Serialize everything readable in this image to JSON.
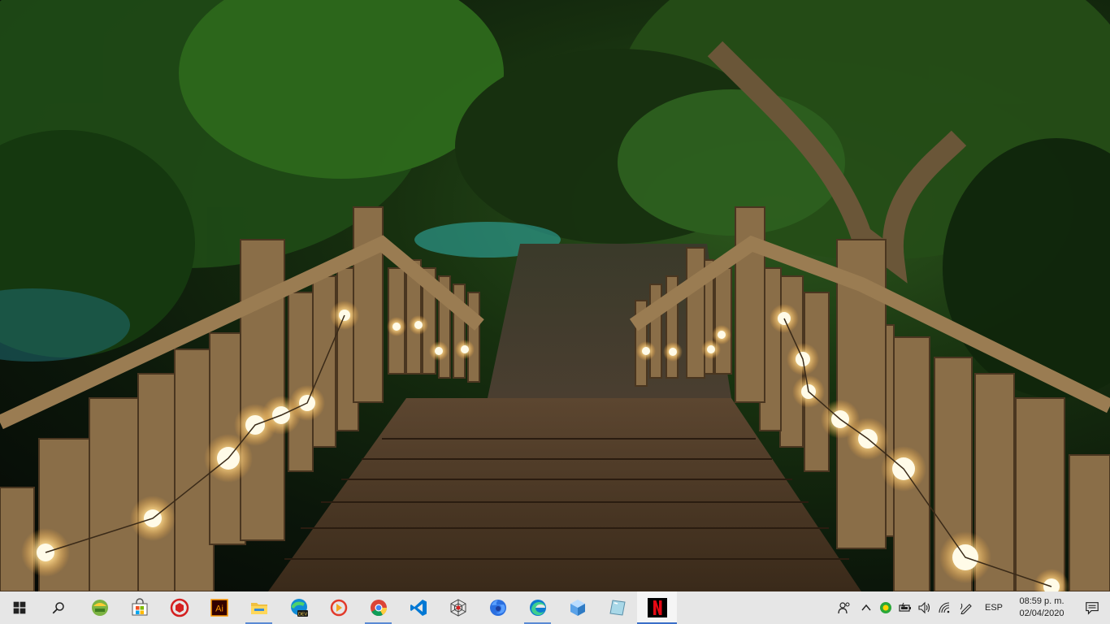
{
  "taskbar": {
    "start": {
      "icon": "windows-logo-icon"
    },
    "search": {
      "icon": "search-icon"
    },
    "apps": [
      {
        "name": "app-launcher-green-icon",
        "running": false
      },
      {
        "name": "microsoft-store-icon",
        "running": false
      },
      {
        "name": "red-hexagon-app-icon",
        "running": false
      },
      {
        "name": "adobe-illustrator-icon",
        "running": false
      },
      {
        "name": "file-explorer-icon",
        "running": true
      },
      {
        "name": "edge-dev-icon",
        "running": false
      },
      {
        "name": "red-circle-app-icon",
        "running": false
      },
      {
        "name": "google-chrome-icon",
        "running": true
      },
      {
        "name": "visual-studio-code-icon",
        "running": false
      },
      {
        "name": "spider-web-app-icon",
        "running": false
      },
      {
        "name": "firefox-icon",
        "running": false
      },
      {
        "name": "microsoft-edge-icon",
        "running": true
      },
      {
        "name": "blue-cube-app-icon",
        "running": false
      },
      {
        "name": "glass-panel-app-icon",
        "running": false
      },
      {
        "name": "netflix-icon",
        "running": true,
        "active": true
      }
    ]
  },
  "tray": {
    "icons": [
      "people-icon",
      "chevron-up-icon",
      "green-circle-app-icon",
      "battery-icon",
      "volume-icon",
      "wifi-icon",
      "pen-icon"
    ],
    "language": "ESP",
    "time": "08:59 p. m.",
    "date": "02/04/2020",
    "notification_icon": "action-center-icon"
  },
  "colors": {
    "taskbar_bg": "#e6e6e6",
    "running_indicator": "#5a8ad4",
    "active_indicator": "#3a6fc8"
  }
}
